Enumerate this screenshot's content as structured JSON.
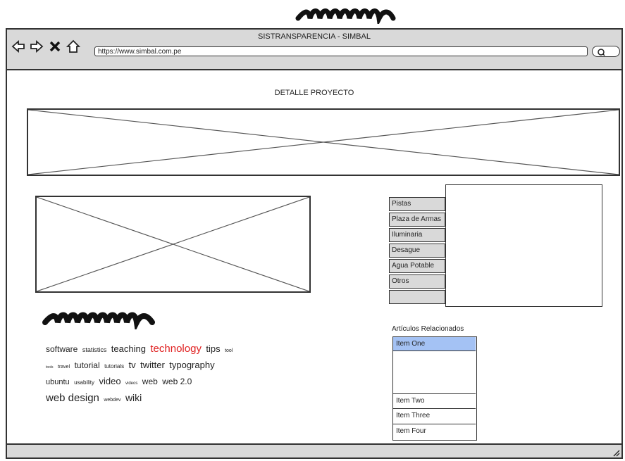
{
  "window": {
    "title": "SISTRANSPARENCIA - SIMBAL",
    "url": "https://www.simbal.com.pe"
  },
  "nav_icons": [
    "back-arrow-icon",
    "forward-arrow-icon",
    "close-x-icon",
    "home-icon",
    "search-icon"
  ],
  "page": {
    "heading": "DETALLE PROYECTO"
  },
  "tabs": [
    "Pistas",
    "Plaza de Armas",
    "Iluminaria",
    "Desague",
    "Agua Potable",
    "Otros",
    ""
  ],
  "tagcloud": [
    {
      "text": "software",
      "size": 12
    },
    {
      "text": "statistics",
      "size": 9
    },
    {
      "text": "teaching",
      "size": 13
    },
    {
      "text": "technology",
      "size": 15,
      "color": "#e02020"
    },
    {
      "text": "tips",
      "size": 13
    },
    {
      "text": "tool",
      "size": 7
    },
    {
      "text": "tools",
      "size": 5
    },
    {
      "text": "travel",
      "size": 7
    },
    {
      "text": "tutorial",
      "size": 12
    },
    {
      "text": "tutorials",
      "size": 8
    },
    {
      "text": "tv",
      "size": 13
    },
    {
      "text": "twitter",
      "size": 13
    },
    {
      "text": "typography",
      "size": 13
    },
    {
      "text": "ubuntu",
      "size": 11
    },
    {
      "text": "usability",
      "size": 8
    },
    {
      "text": "video",
      "size": 13
    },
    {
      "text": "videos",
      "size": 6
    },
    {
      "text": "web",
      "size": 12
    },
    {
      "text": "web 2.0",
      "size": 12
    },
    {
      "text": "web design",
      "size": 15
    },
    {
      "text": "webdev",
      "size": 7
    },
    {
      "text": "wiki",
      "size": 14
    }
  ],
  "related": {
    "title": "Artículos Relacionados",
    "items": [
      "Item One",
      "Item Two",
      "Item Three",
      "Item Four"
    ]
  },
  "colors": {
    "chrome": "#d9d9d9",
    "selected": "#a4c2f4",
    "highlight": "#e02020"
  }
}
